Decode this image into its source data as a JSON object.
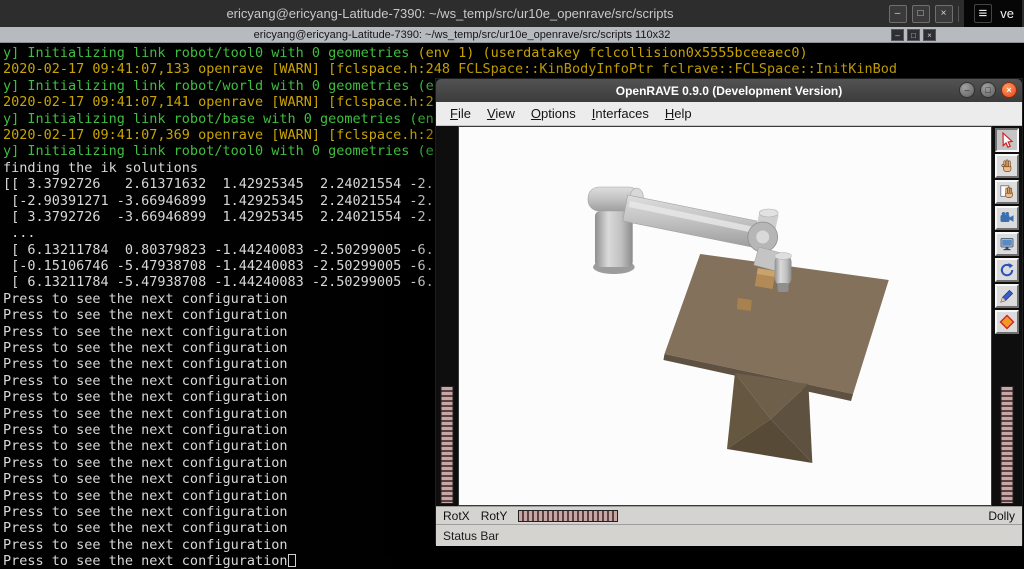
{
  "top_panel": {
    "title": "ericyang@ericyang-Latitude-7390: ~/ws_temp/src/ur10e_openrave/src/scripts",
    "buttons": {
      "minimize": "–",
      "maximize": "□",
      "close": "×"
    },
    "menu_glyph": "≡",
    "corner_text": "ve"
  },
  "xterm_titlebar": {
    "title": "ericyang@ericyang-Latitude-7390: ~/ws_temp/src/ur10e_openrave/src/scripts 110x32",
    "buttons": {
      "minimize": "–",
      "maximize": "□",
      "close": "×"
    }
  },
  "colors": {
    "green": "#3fbe3f",
    "yellow": "#c9a403",
    "white": "#d8d8d8",
    "close_button": "#e2481c",
    "table_brown": "#83715c",
    "robot_gray": "#c2c2c2"
  },
  "terminal": {
    "lines": [
      {
        "segments": [
          {
            "color": "green",
            "text": "y] Initializing link robot/tool0 with 0 geometries "
          },
          {
            "color": "yellow",
            "text": "(env 1) (userdatakey fclcollision0x5555bceeaec0)"
          }
        ]
      },
      {
        "segments": [
          {
            "color": "yellow",
            "text": "2020-02-17 09:41:07,133 openrave [WARN] [fclspace.h:248 FCLSpace::KinBodyInfoPtr fclrave::FCLSpace::InitKinBod"
          }
        ]
      },
      {
        "segments": [
          {
            "color": "green",
            "text": "y] Initializing link robot/world with 0 geometries (e"
          }
        ]
      },
      {
        "segments": [
          {
            "color": "yellow",
            "text": "2020-02-17 09:41:07,141 openrave [WARN] [fclspace.h:2"
          }
        ]
      },
      {
        "segments": [
          {
            "color": "green",
            "text": "y] Initializing link robot/base with 0 geometries (en"
          }
        ]
      },
      {
        "segments": [
          {
            "color": "yellow",
            "text": "2020-02-17 09:41:07,369 openrave [WARN] [fclspace.h:2"
          }
        ]
      },
      {
        "segments": [
          {
            "color": "green",
            "text": "y] Initializing link robot/tool0 with 0 geometries (e"
          }
        ]
      },
      {
        "segments": [
          {
            "color": "white",
            "text": "finding the ik solutions"
          }
        ]
      },
      {
        "segments": [
          {
            "color": "white",
            "text": "[[ 3.3792726   2.61371632  1.42925345  2.24021554 -2."
          }
        ]
      },
      {
        "segments": [
          {
            "color": "white",
            "text": " [-2.90391271 -3.66946899  1.42925345  2.24021554 -2."
          }
        ]
      },
      {
        "segments": [
          {
            "color": "white",
            "text": " [ 3.3792726  -3.66946899  1.42925345  2.24021554 -2."
          }
        ]
      },
      {
        "segments": [
          {
            "color": "white",
            "text": " ..."
          }
        ]
      },
      {
        "segments": [
          {
            "color": "white",
            "text": " [ 6.13211784  0.80379823 -1.44240083 -2.50299005 -6."
          }
        ]
      },
      {
        "segments": [
          {
            "color": "white",
            "text": " [-0.15106746 -5.47938708 -1.44240083 -2.50299005 -6."
          }
        ]
      },
      {
        "segments": [
          {
            "color": "white",
            "text": " [ 6.13211784 -5.47938708 -1.44240083 -2.50299005 -6."
          }
        ]
      }
    ],
    "press_line": {
      "text": "Press to see the next configuration",
      "count": 17
    },
    "cursor_visible": true
  },
  "openrave_window": {
    "title": "OpenRAVE 0.9.0 (Development Version)",
    "window_buttons": {
      "minimize": "–",
      "maximize": "□",
      "close": "×"
    },
    "menu": [
      "File",
      "View",
      "Options",
      "Interfaces",
      "Help"
    ],
    "toolbar": [
      "pointer",
      "hand",
      "hand-page",
      "camera",
      "monitor",
      "rotate",
      "pen",
      "diamond"
    ],
    "controls": {
      "rotx": "RotX",
      "roty": "RotY",
      "dolly": "Dolly"
    },
    "status_bar": "Status Bar"
  }
}
